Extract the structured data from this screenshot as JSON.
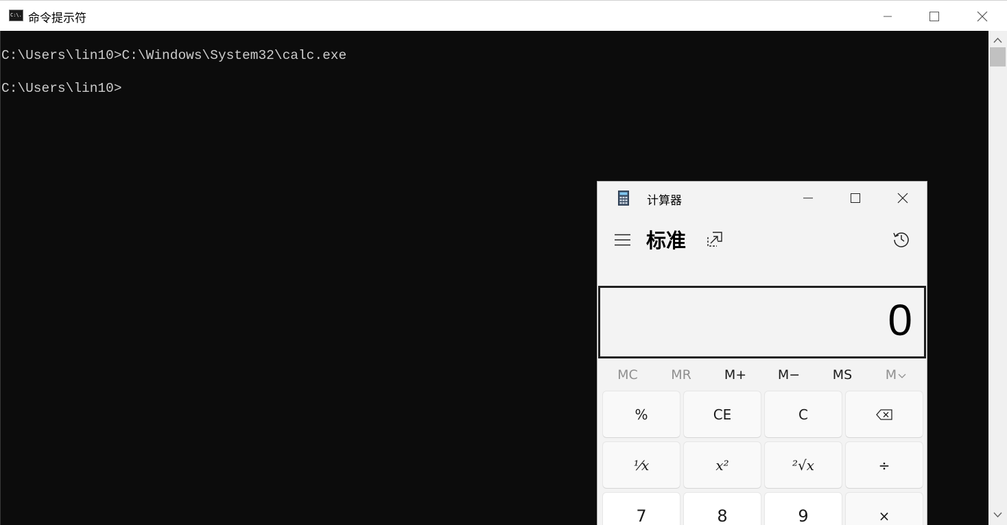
{
  "cmd": {
    "title": "命令提示符",
    "icon_text": "C:\\.",
    "lines": [
      "C:\\Users\\lin10>C:\\Windows\\System32\\calc.exe",
      "C:\\Users\\lin10>"
    ],
    "colors": {
      "background": "#0c0c0c",
      "text": "#cccccc"
    }
  },
  "calculator": {
    "title": "计算器",
    "mode": "标准",
    "display": "0",
    "memory": [
      {
        "label": "MC",
        "enabled": false
      },
      {
        "label": "MR",
        "enabled": false
      },
      {
        "label": "M+",
        "enabled": true
      },
      {
        "label": "M−",
        "enabled": true
      },
      {
        "label": "MS",
        "enabled": true
      },
      {
        "label": "M",
        "enabled": false
      }
    ],
    "keys": {
      "percent": "%",
      "ce": "CE",
      "c": "C",
      "reciprocal": "⅟x",
      "square": "x²",
      "sqrt": "²√x",
      "divide": "÷",
      "seven": "7",
      "eight": "8",
      "nine": "9",
      "multiply": "×"
    },
    "colors": {
      "window": "#f3f3f3",
      "number_key": "#ffffff",
      "operator_key": "#f9f9f9"
    }
  }
}
